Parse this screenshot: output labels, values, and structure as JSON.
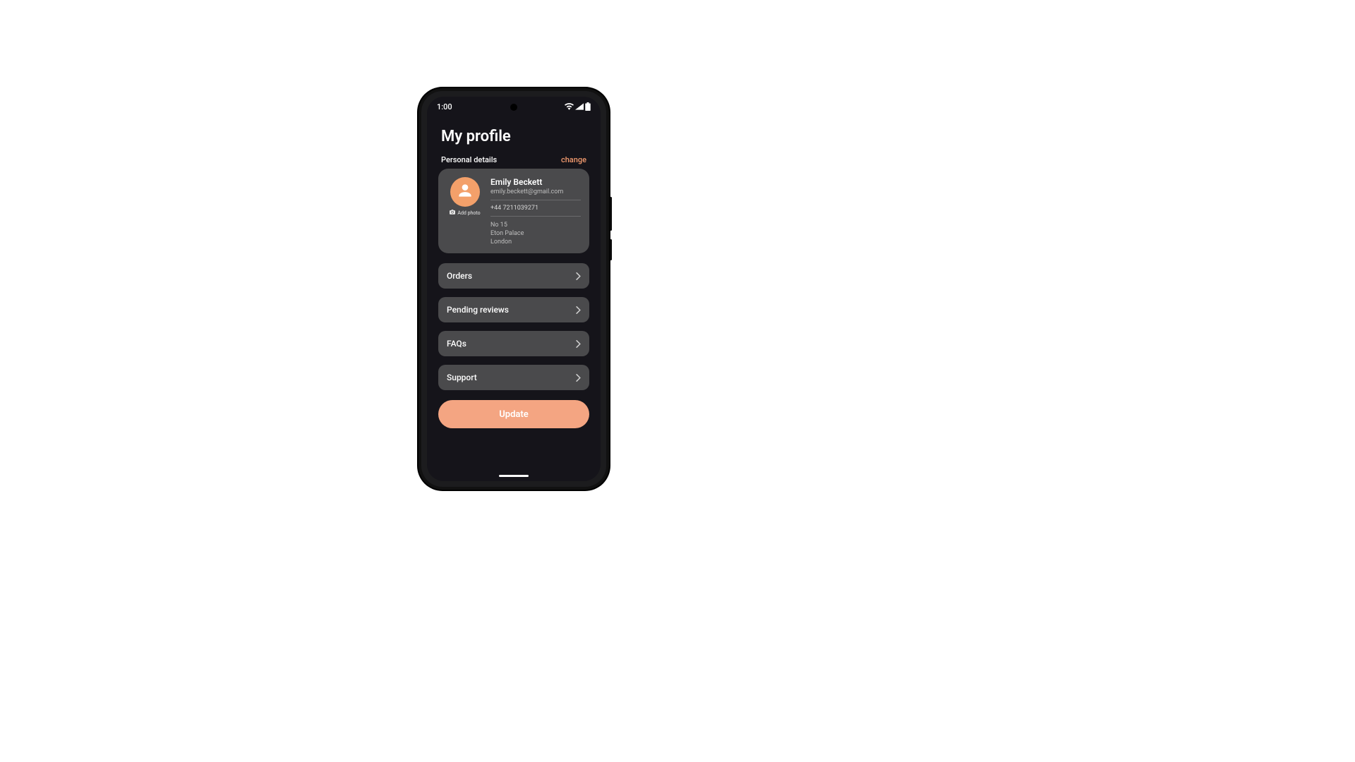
{
  "status": {
    "time": "1:00"
  },
  "title": "My profile",
  "section": {
    "label": "Personal details",
    "change": "change"
  },
  "profile": {
    "add_photo": "Add photo",
    "name": "Emily Beckett",
    "email": "emily.beckett@gmail.com",
    "phone": "+44 7211039271",
    "addr1": "No 15",
    "addr2": "Eton Palace",
    "addr3": "London"
  },
  "menu": {
    "orders": "Orders",
    "pending_reviews": "Pending reviews",
    "faqs": "FAQs",
    "support": "Support"
  },
  "update_label": "Update",
  "colors": {
    "accent": "#f4a582",
    "avatar": "#f3a06a",
    "card": "#4a4a4c",
    "bg": "#15141a"
  }
}
